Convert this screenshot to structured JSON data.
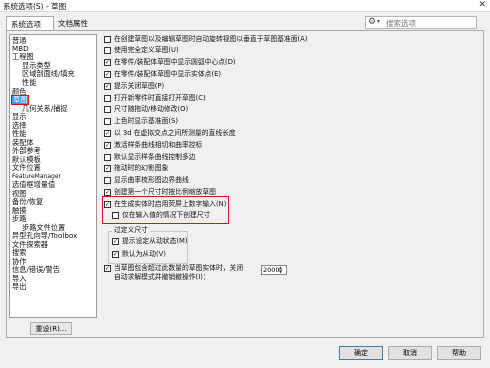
{
  "window": {
    "title": "系统选项(S) - 草图",
    "close_glyph": "✕"
  },
  "tabs": [
    {
      "label": "系统选项(S)"
    },
    {
      "label": "文档属性(D)"
    }
  ],
  "search": {
    "placeholder": "搜索选项"
  },
  "nav": {
    "items": [
      "普通",
      "MBD",
      "工程图",
      "显示类型",
      "区域剖面线/填充",
      "性能",
      "颜色",
      "草图",
      "几何关系/捕捉",
      "显示",
      "选择",
      "性能",
      "装配体",
      "外部参考",
      "默认模板",
      "文件位置",
      "FeatureManager",
      "选值框增量值",
      "视图",
      "备份/恢复",
      "触摸",
      "步路",
      "步路文件位置",
      "异型孔向导/Toolbox",
      "文件探索器",
      "搜索",
      "协作",
      "信息/错误/警告",
      "导入",
      "导出"
    ],
    "selected": "草图"
  },
  "reset_button": "重设(R)...",
  "options": [
    {
      "label": "在创建草图以及编辑草图时自动旋转视图以垂直于草图基准面(A)",
      "checked": false
    },
    {
      "label": "使用完全定义草图(U)",
      "checked": false
    },
    {
      "label": "在零件/装配体草图中显示圆弧中心点(D)",
      "checked": true
    },
    {
      "label": "在零件/装配体草图中显示实体点(E)",
      "checked": true
    },
    {
      "label": "提示关闭草图(P)",
      "checked": true
    },
    {
      "label": "打开新零件时直接打开草图(C)",
      "checked": false
    },
    {
      "label": "尺寸随拖动/移动修改(O)",
      "checked": false
    },
    {
      "label": "上色时显示基准面(S)",
      "checked": false
    },
    {
      "label": "以 3d 在虚拟交点之间所测量的直线长度",
      "checked": true
    },
    {
      "label": "激活样条曲线相切和曲率控标",
      "checked": true
    },
    {
      "label": "默认显示样条曲线控制多边",
      "checked": false
    },
    {
      "label": "拖动时的幻影图象",
      "checked": true
    },
    {
      "label": "显示曲率梳形图边界曲线",
      "checked": false
    },
    {
      "label": "创建第一个尺寸时按比例缩放草图",
      "checked": true
    },
    {
      "label": "在生成实体时启用荧屏上数字输入(N)",
      "checked": true
    },
    {
      "label": "仅在输入值的情况下创建尺寸",
      "checked": false
    }
  ],
  "overdefine": {
    "title": "过定义尺寸",
    "options": [
      {
        "label": "提示设定从动状态(M)",
        "checked": true
      },
      {
        "label": "默认为从动(V)",
        "checked": true
      }
    ]
  },
  "perf_option": {
    "label_line1": "当草图包含超过此数量的草图实体时，关闭",
    "label_line2": "自动求解模式并撤销撤操作(I)：",
    "checked": true,
    "value": "2000"
  },
  "buttons": {
    "ok": "确定",
    "cancel": "取消",
    "help": "帮助"
  }
}
